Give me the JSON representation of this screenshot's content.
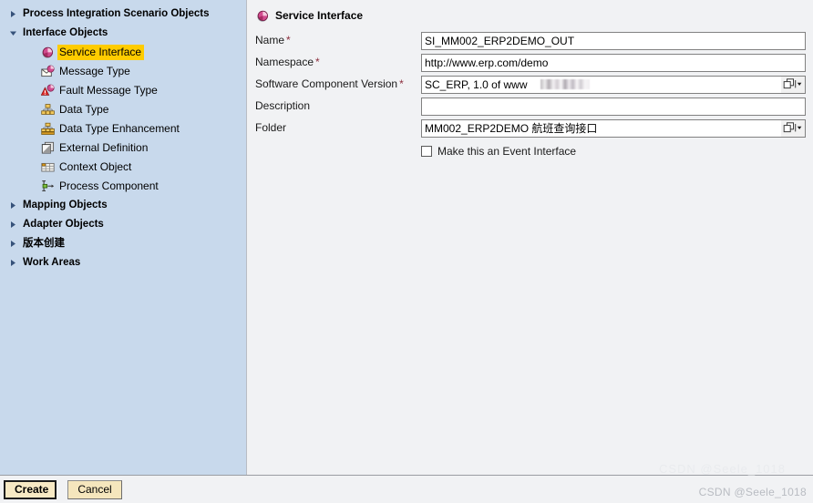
{
  "window": {
    "accent_selected": "#ffcc00",
    "sidebar_bg": "#c8d9ec",
    "content_bg": "#f1f2f4",
    "required_marker_color": "#8c2d3c"
  },
  "sidebar": {
    "items": [
      {
        "label": "Process Integration Scenario Objects",
        "icon": "triangle-right-icon",
        "level": "top",
        "expanded": false
      },
      {
        "label": "Interface Objects",
        "icon": "triangle-down-icon",
        "level": "top",
        "expanded": true
      },
      {
        "label": "Service Interface",
        "icon": "service-interface-icon",
        "level": "child",
        "selected": true
      },
      {
        "label": "Message Type",
        "icon": "message-type-icon",
        "level": "child",
        "selected": false
      },
      {
        "label": "Fault Message Type",
        "icon": "fault-message-type-icon",
        "level": "child",
        "selected": false
      },
      {
        "label": "Data Type",
        "icon": "data-type-icon",
        "level": "child",
        "selected": false
      },
      {
        "label": "Data Type Enhancement",
        "icon": "data-type-enhancement-icon",
        "level": "child",
        "selected": false
      },
      {
        "label": "External Definition",
        "icon": "external-definition-icon",
        "level": "child",
        "selected": false
      },
      {
        "label": "Context Object",
        "icon": "context-object-icon",
        "level": "child",
        "selected": false
      },
      {
        "label": "Process Component",
        "icon": "process-component-icon",
        "level": "child",
        "selected": false
      },
      {
        "label": "Mapping Objects",
        "icon": "triangle-right-icon",
        "level": "top",
        "expanded": false
      },
      {
        "label": "Adapter Objects",
        "icon": "triangle-right-icon",
        "level": "top",
        "expanded": false
      },
      {
        "label": "版本创建",
        "icon": "triangle-right-icon",
        "level": "top",
        "expanded": false
      },
      {
        "label": "Work Areas",
        "icon": "triangle-right-icon",
        "level": "top",
        "expanded": false
      }
    ]
  },
  "pane": {
    "title": "Service Interface",
    "title_icon": "service-interface-icon",
    "fields": [
      {
        "label": "Name",
        "required": true,
        "value": "SI_MM002_ERP2DEMO_OUT",
        "placeholder": "",
        "has_help": false
      },
      {
        "label": "Namespace",
        "required": true,
        "value": "http://www.erp.com/demo",
        "placeholder": "",
        "has_help": false
      },
      {
        "label": "Software Component Version",
        "required": true,
        "value": "SC_ERP, 1.0 of www",
        "placeholder": "",
        "has_help": true,
        "redacted_tail": true
      },
      {
        "label": "Description",
        "required": false,
        "value": "",
        "placeholder": "",
        "has_help": false
      },
      {
        "label": "Folder",
        "required": false,
        "value": "MM002_ERP2DEMO 航班查询接口",
        "placeholder": "",
        "has_help": true
      }
    ],
    "checkbox": {
      "label": "Make this an Event Interface",
      "checked": false
    }
  },
  "footer": {
    "create_label": "Create",
    "cancel_label": "Cancel"
  },
  "watermark": {
    "text": "CSDN @Seele_1018",
    "ghost_text": "CSDN @Seele_1018"
  }
}
